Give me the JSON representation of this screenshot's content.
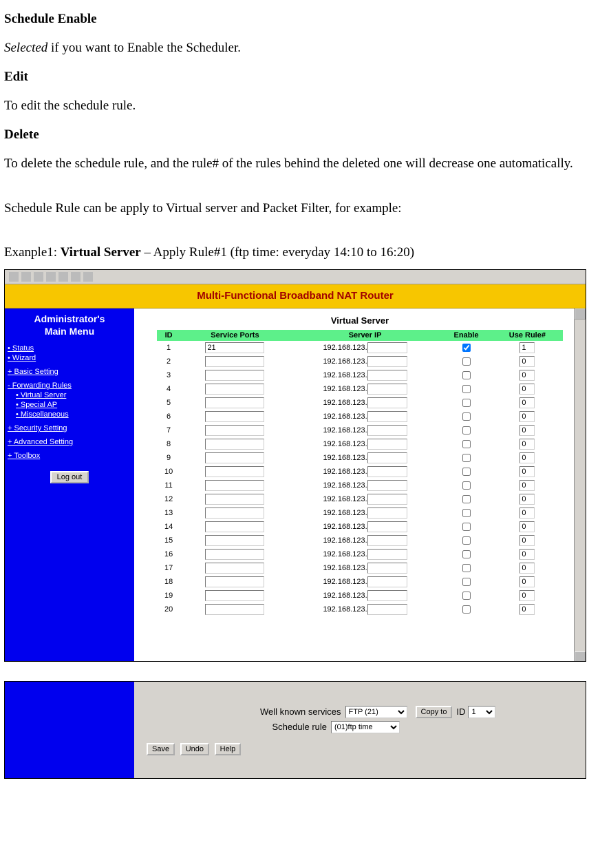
{
  "doc": {
    "item1_title": "Schedule Enable",
    "item1_text_a": "Selected",
    "item1_text_b": " if you want to Enable the Scheduler.",
    "item2_title": "Edit",
    "item2_text": "To edit the schedule rule.",
    "item3_title": "Delete",
    "item3_text": "To delete the schedule rule, and the rule# of the rules behind the deleted one will decrease one automatically.",
    "sentence2": "Schedule Rule can be apply to Virtual server and Packet Filter, for example:",
    "example_prefix": "Exanple1: ",
    "example_bold": "Virtual Server",
    "example_suffix": " – Apply Rule#1 (ftp time: everyday 14:10 to 16:20)"
  },
  "router": {
    "title_bar": "Multi-Functional Broadband NAT Router",
    "sidebar": {
      "admin_title_l1": "Administrator's",
      "admin_title_l2": "Main Menu",
      "items_top": [
        "Status",
        "Wizard"
      ],
      "basic": "+ Basic Setting",
      "fwd_head": "- Forwarding Rules",
      "fwd_items": [
        "Virtual Server",
        "Special AP",
        "Miscellaneous"
      ],
      "security": "+ Security Setting",
      "advanced": "+ Advanced Setting",
      "toolbox": "+ Toolbox",
      "logout": "Log out"
    },
    "content": {
      "page_heading": "Virtual Server",
      "headers": [
        "ID",
        "Service Ports",
        "Server IP",
        "Enable",
        "Use Rule#"
      ],
      "ip_prefix": "192.168.123.",
      "rows": [
        {
          "id": "1",
          "port": "21",
          "ip": "",
          "enable": true,
          "rule": "1"
        },
        {
          "id": "2",
          "port": "",
          "ip": "",
          "enable": false,
          "rule": "0"
        },
        {
          "id": "3",
          "port": "",
          "ip": "",
          "enable": false,
          "rule": "0"
        },
        {
          "id": "4",
          "port": "",
          "ip": "",
          "enable": false,
          "rule": "0"
        },
        {
          "id": "5",
          "port": "",
          "ip": "",
          "enable": false,
          "rule": "0"
        },
        {
          "id": "6",
          "port": "",
          "ip": "",
          "enable": false,
          "rule": "0"
        },
        {
          "id": "7",
          "port": "",
          "ip": "",
          "enable": false,
          "rule": "0"
        },
        {
          "id": "8",
          "port": "",
          "ip": "",
          "enable": false,
          "rule": "0"
        },
        {
          "id": "9",
          "port": "",
          "ip": "",
          "enable": false,
          "rule": "0"
        },
        {
          "id": "10",
          "port": "",
          "ip": "",
          "enable": false,
          "rule": "0"
        },
        {
          "id": "11",
          "port": "",
          "ip": "",
          "enable": false,
          "rule": "0"
        },
        {
          "id": "12",
          "port": "",
          "ip": "",
          "enable": false,
          "rule": "0"
        },
        {
          "id": "13",
          "port": "",
          "ip": "",
          "enable": false,
          "rule": "0"
        },
        {
          "id": "14",
          "port": "",
          "ip": "",
          "enable": false,
          "rule": "0"
        },
        {
          "id": "15",
          "port": "",
          "ip": "",
          "enable": false,
          "rule": "0"
        },
        {
          "id": "16",
          "port": "",
          "ip": "",
          "enable": false,
          "rule": "0"
        },
        {
          "id": "17",
          "port": "",
          "ip": "",
          "enable": false,
          "rule": "0"
        },
        {
          "id": "18",
          "port": "",
          "ip": "",
          "enable": false,
          "rule": "0"
        },
        {
          "id": "19",
          "port": "",
          "ip": "",
          "enable": false,
          "rule": "0"
        },
        {
          "id": "20",
          "port": "",
          "ip": "",
          "enable": false,
          "rule": "0"
        }
      ]
    }
  },
  "panel2": {
    "wks_label": "Well known services",
    "wks_value": "FTP (21)",
    "copy_to": "Copy to",
    "id_label": "ID",
    "id_value": "1",
    "sched_label": "Schedule rule",
    "sched_value": "(01)ftp time",
    "btn_save": "Save",
    "btn_undo": "Undo",
    "btn_help": "Help"
  }
}
